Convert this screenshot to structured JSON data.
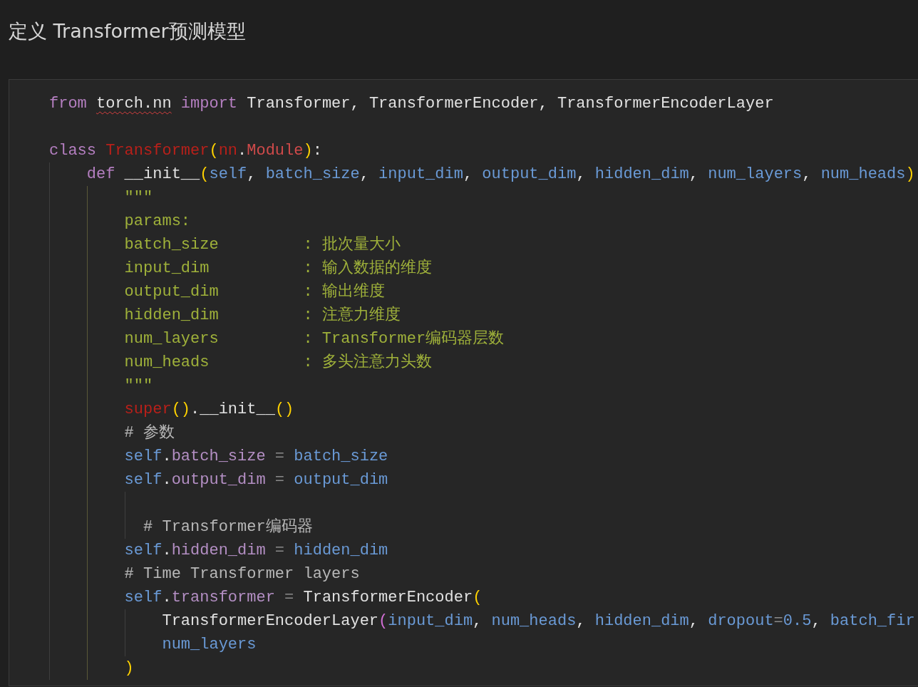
{
  "heading": "定义 Transformer预测模型",
  "code_block": {
    "lines": [
      {
        "kind": "code",
        "tokens": [
          {
            "kind": "keyword",
            "text": "from "
          },
          {
            "kind": "unresolved",
            "text": "torch.nn"
          },
          {
            "kind": "keyword",
            "text": " import"
          },
          {
            "kind": "plain",
            "text": " Transformer, TransformerEncoder, TransformerEncoderLayer"
          }
        ]
      },
      {
        "kind": "blank"
      },
      {
        "kind": "code",
        "tokens": [
          {
            "kind": "keyword",
            "text": "class "
          },
          {
            "kind": "class_name",
            "text": "Transformer"
          },
          {
            "kind": "bracket",
            "text": "("
          },
          {
            "kind": "class_name",
            "text": "nn"
          },
          {
            "kind": "plain",
            "text": "."
          },
          {
            "kind": "module",
            "text": "Module"
          },
          {
            "kind": "bracket",
            "text": ")"
          },
          {
            "kind": "plain",
            "text": ":"
          }
        ]
      },
      {
        "kind": "code",
        "tokens": [
          {
            "kind": "keyword",
            "text": "    def"
          },
          {
            "kind": "plain",
            "text": " __init__"
          },
          {
            "kind": "bracket",
            "text": "("
          },
          {
            "kind": "param",
            "text": "self"
          },
          {
            "kind": "plain",
            "text": ", "
          },
          {
            "kind": "param",
            "text": "batch_size"
          },
          {
            "kind": "plain",
            "text": ", "
          },
          {
            "kind": "param",
            "text": "input_dim"
          },
          {
            "kind": "plain",
            "text": ", "
          },
          {
            "kind": "param",
            "text": "output_dim"
          },
          {
            "kind": "plain",
            "text": ", "
          },
          {
            "kind": "param",
            "text": "hidden_dim"
          },
          {
            "kind": "plain",
            "text": ", "
          },
          {
            "kind": "param",
            "text": "num_layers"
          },
          {
            "kind": "plain",
            "text": ", "
          },
          {
            "kind": "param",
            "text": "num_heads"
          },
          {
            "kind": "bracket",
            "text": ")"
          }
        ]
      },
      {
        "kind": "code",
        "tokens": [
          {
            "kind": "string",
            "text": "        \"\"\""
          }
        ]
      },
      {
        "kind": "code",
        "tokens": [
          {
            "kind": "string",
            "text": "        params:"
          }
        ]
      },
      {
        "kind": "code",
        "tokens": [
          {
            "kind": "string",
            "text": "        batch_size         : 批次量大小"
          }
        ]
      },
      {
        "kind": "code",
        "tokens": [
          {
            "kind": "string",
            "text": "        input_dim          : 输入数据的维度"
          }
        ]
      },
      {
        "kind": "code",
        "tokens": [
          {
            "kind": "string",
            "text": "        output_dim         : 输出维度"
          }
        ]
      },
      {
        "kind": "code",
        "tokens": [
          {
            "kind": "string",
            "text": "        hidden_dim         : 注意力维度"
          }
        ]
      },
      {
        "kind": "code",
        "tokens": [
          {
            "kind": "string",
            "text": "        num_layers         : Transformer编码器层数"
          }
        ]
      },
      {
        "kind": "code",
        "tokens": [
          {
            "kind": "string",
            "text": "        num_heads          : 多头注意力头数"
          }
        ]
      },
      {
        "kind": "code",
        "tokens": [
          {
            "kind": "string",
            "text": "        \"\"\""
          }
        ]
      },
      {
        "kind": "code",
        "tokens": [
          {
            "kind": "class_name",
            "text": "        super"
          },
          {
            "kind": "bracket",
            "text": "()"
          },
          {
            "kind": "plain",
            "text": ".__init__"
          },
          {
            "kind": "bracket",
            "text": "()"
          }
        ]
      },
      {
        "kind": "code",
        "tokens": [
          {
            "kind": "comment",
            "text": "        # 参数"
          }
        ]
      },
      {
        "kind": "code",
        "tokens": [
          {
            "kind": "param",
            "text": "        self"
          },
          {
            "kind": "plain",
            "text": "."
          },
          {
            "kind": "attribute",
            "text": "batch_size"
          },
          {
            "kind": "operator",
            "text": " = "
          },
          {
            "kind": "param",
            "text": "batch_size"
          }
        ]
      },
      {
        "kind": "code",
        "tokens": [
          {
            "kind": "param",
            "text": "        self"
          },
          {
            "kind": "plain",
            "text": "."
          },
          {
            "kind": "attribute",
            "text": "output_dim"
          },
          {
            "kind": "operator",
            "text": " = "
          },
          {
            "kind": "param",
            "text": "output_dim"
          }
        ]
      },
      {
        "kind": "blank"
      },
      {
        "kind": "code",
        "tokens": [
          {
            "kind": "comment",
            "text": "          # Transformer编码器"
          }
        ]
      },
      {
        "kind": "code",
        "tokens": [
          {
            "kind": "param",
            "text": "        self"
          },
          {
            "kind": "plain",
            "text": "."
          },
          {
            "kind": "attribute",
            "text": "hidden_dim"
          },
          {
            "kind": "operator",
            "text": " = "
          },
          {
            "kind": "param",
            "text": "hidden_dim"
          }
        ]
      },
      {
        "kind": "code",
        "tokens": [
          {
            "kind": "comment",
            "text": "        # Time Transformer layers"
          }
        ]
      },
      {
        "kind": "code",
        "tokens": [
          {
            "kind": "param",
            "text": "        self"
          },
          {
            "kind": "plain",
            "text": "."
          },
          {
            "kind": "attribute",
            "text": "transformer"
          },
          {
            "kind": "operator",
            "text": " = "
          },
          {
            "kind": "plain",
            "text": "TransformerEncoder"
          },
          {
            "kind": "bracket",
            "text": "("
          }
        ]
      },
      {
        "kind": "code",
        "tokens": [
          {
            "kind": "plain",
            "text": "            TransformerEncoderLayer"
          },
          {
            "kind": "inner_bracket",
            "text": "("
          },
          {
            "kind": "param",
            "text": "input_dim"
          },
          {
            "kind": "plain",
            "text": ", "
          },
          {
            "kind": "param",
            "text": "num_heads"
          },
          {
            "kind": "plain",
            "text": ", "
          },
          {
            "kind": "param",
            "text": "hidden_dim"
          },
          {
            "kind": "plain",
            "text": ", "
          },
          {
            "kind": "param",
            "text": "dropout"
          },
          {
            "kind": "operator",
            "text": "="
          },
          {
            "kind": "param",
            "text": "0.5"
          },
          {
            "kind": "plain",
            "text": ", "
          },
          {
            "kind": "param",
            "text": "batch_fir"
          }
        ]
      },
      {
        "kind": "code",
        "tokens": [
          {
            "kind": "param",
            "text": "            num_layers"
          }
        ]
      },
      {
        "kind": "code",
        "tokens": [
          {
            "kind": "bracket",
            "text": "        )"
          }
        ]
      }
    ]
  }
}
